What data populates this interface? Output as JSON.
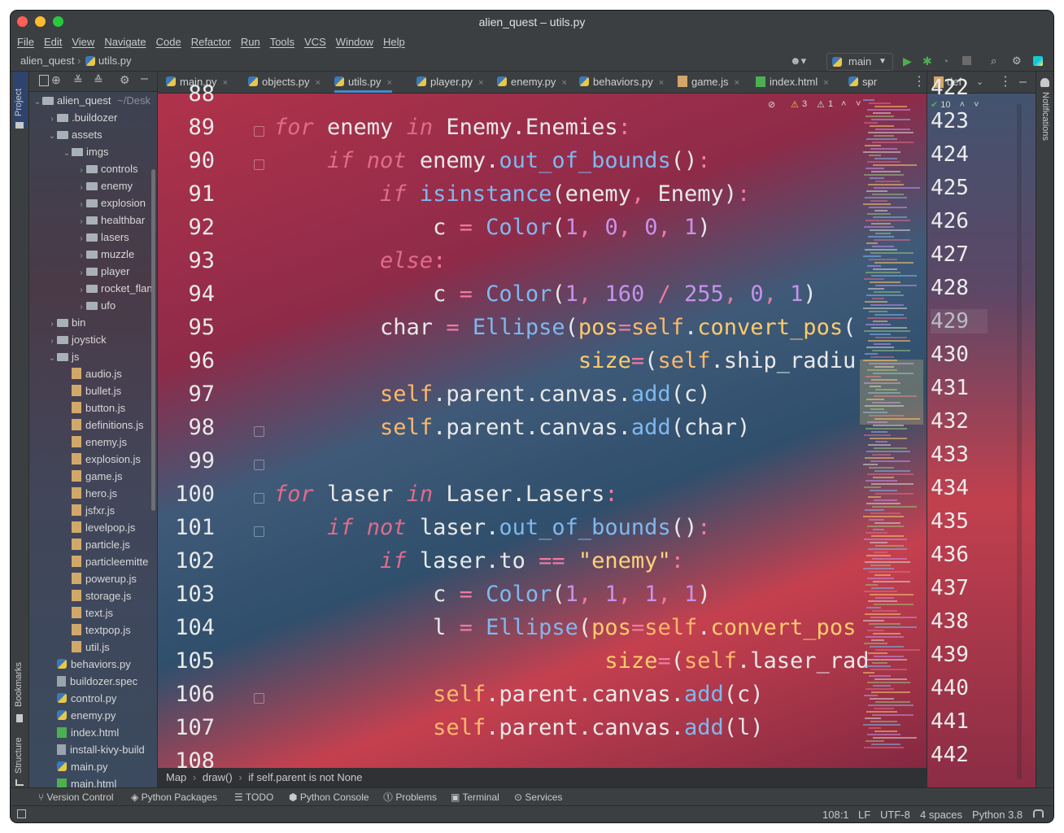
{
  "window": {
    "title": "alien_quest – utils.py"
  },
  "menu": [
    "File",
    "Edit",
    "View",
    "Navigate",
    "Code",
    "Refactor",
    "Run",
    "Tools",
    "VCS",
    "Window",
    "Help"
  ],
  "nav": {
    "project": "alien_quest",
    "file": "utils.py",
    "branch": "main"
  },
  "side_tools": {
    "project": "Project",
    "bookmarks": "Bookmarks",
    "structure": "Structure",
    "notifications": "Notifications"
  },
  "project_tree": {
    "root": "alien_quest",
    "root_path": "~/Desk",
    "items": [
      {
        "label": ".buildozer",
        "kind": "folder",
        "depth": 1,
        "exp": "collapsed"
      },
      {
        "label": "assets",
        "kind": "folder",
        "depth": 1,
        "exp": "expanded"
      },
      {
        "label": "imgs",
        "kind": "folder",
        "depth": 2,
        "exp": "expanded"
      },
      {
        "label": "controls",
        "kind": "folder",
        "depth": 3,
        "exp": "collapsed"
      },
      {
        "label": "enemy",
        "kind": "folder",
        "depth": 3,
        "exp": "collapsed"
      },
      {
        "label": "explosion",
        "kind": "folder",
        "depth": 3,
        "exp": "collapsed"
      },
      {
        "label": "healthbar",
        "kind": "folder",
        "depth": 3,
        "exp": "collapsed"
      },
      {
        "label": "lasers",
        "kind": "folder",
        "depth": 3,
        "exp": "collapsed"
      },
      {
        "label": "muzzle",
        "kind": "folder",
        "depth": 3,
        "exp": "collapsed"
      },
      {
        "label": "player",
        "kind": "folder",
        "depth": 3,
        "exp": "collapsed"
      },
      {
        "label": "rocket_flan",
        "kind": "folder",
        "depth": 3,
        "exp": "collapsed"
      },
      {
        "label": "ufo",
        "kind": "folder",
        "depth": 3,
        "exp": "collapsed"
      },
      {
        "label": "bin",
        "kind": "folder",
        "depth": 1,
        "exp": "collapsed"
      },
      {
        "label": "joystick",
        "kind": "folder",
        "depth": 1,
        "exp": "collapsed"
      },
      {
        "label": "js",
        "kind": "folder",
        "depth": 1,
        "exp": "expanded"
      },
      {
        "label": "audio.js",
        "kind": "js",
        "depth": 2
      },
      {
        "label": "bullet.js",
        "kind": "js",
        "depth": 2
      },
      {
        "label": "button.js",
        "kind": "js",
        "depth": 2
      },
      {
        "label": "definitions.js",
        "kind": "js",
        "depth": 2
      },
      {
        "label": "enemy.js",
        "kind": "js",
        "depth": 2
      },
      {
        "label": "explosion.js",
        "kind": "js",
        "depth": 2
      },
      {
        "label": "game.js",
        "kind": "js",
        "depth": 2
      },
      {
        "label": "hero.js",
        "kind": "js",
        "depth": 2
      },
      {
        "label": "jsfxr.js",
        "kind": "js",
        "depth": 2
      },
      {
        "label": "levelpop.js",
        "kind": "js",
        "depth": 2
      },
      {
        "label": "particle.js",
        "kind": "js",
        "depth": 2
      },
      {
        "label": "particleemitte",
        "kind": "js",
        "depth": 2
      },
      {
        "label": "powerup.js",
        "kind": "js",
        "depth": 2
      },
      {
        "label": "storage.js",
        "kind": "js",
        "depth": 2
      },
      {
        "label": "text.js",
        "kind": "js",
        "depth": 2
      },
      {
        "label": "textpop.js",
        "kind": "js",
        "depth": 2
      },
      {
        "label": "util.js",
        "kind": "js",
        "depth": 2
      },
      {
        "label": "behaviors.py",
        "kind": "py",
        "depth": 1
      },
      {
        "label": "buildozer.spec",
        "kind": "gen",
        "depth": 1
      },
      {
        "label": "control.py",
        "kind": "py",
        "depth": 1
      },
      {
        "label": "enemy.py",
        "kind": "py",
        "depth": 1
      },
      {
        "label": "index.html",
        "kind": "html",
        "depth": 1
      },
      {
        "label": "install-kivy-build",
        "kind": "gen",
        "depth": 1
      },
      {
        "label": "main.py",
        "kind": "py",
        "depth": 1
      },
      {
        "label": "main.html",
        "kind": "html",
        "depth": 1
      }
    ]
  },
  "tabs": [
    {
      "label": "main.py",
      "kind": "py"
    },
    {
      "label": "objects.py",
      "kind": "py"
    },
    {
      "label": "utils.py",
      "kind": "py",
      "active": true
    },
    {
      "label": "player.py",
      "kind": "py"
    },
    {
      "label": "enemy.py",
      "kind": "py"
    },
    {
      "label": "behaviors.py",
      "kind": "py"
    },
    {
      "label": "game.js",
      "kind": "js"
    },
    {
      "label": "index.html",
      "kind": "html"
    },
    {
      "label": "spr",
      "kind": "py"
    }
  ],
  "right_tab": "def",
  "inspections": {
    "warnings": "3",
    "weak": "1",
    "right_ok": "10"
  },
  "code_lines": [
    {
      "n": "88",
      "html": ""
    },
    {
      "n": "89",
      "html": "<span class='kw'>for</span> enemy <span class='kw'>in</span> Enemy.Enemies<span class='op'>:</span>"
    },
    {
      "n": "90",
      "html": "    <span class='kw'>if not</span> enemy.<span class='fn'>out_of_bounds</span>()<span class='op'>:</span>"
    },
    {
      "n": "91",
      "html": "        <span class='kw'>if</span> <span class='fn'>isinstance</span>(enemy<span class='op'>,</span> Enemy)<span class='op'>:</span>"
    },
    {
      "n": "92",
      "html": "            c <span class='op'>=</span> <span class='fn'>Color</span>(<span class='num'>1</span><span class='op'>,</span> <span class='num'>0</span><span class='op'>,</span> <span class='num'>0</span><span class='op'>,</span> <span class='num'>1</span>)"
    },
    {
      "n": "93",
      "html": "        <span class='kw'>else</span><span class='op'>:</span>"
    },
    {
      "n": "94",
      "html": "            c <span class='op'>=</span> <span class='fn'>Color</span>(<span class='num'>1</span><span class='op'>,</span> <span class='num'>160</span> <span class='op'>/</span> <span class='num'>255</span><span class='op'>,</span> <span class='num'>0</span><span class='op'>,</span> <span class='num'>1</span>)"
    },
    {
      "n": "95",
      "html": "        char <span class='op'>=</span> <span class='fn'>Ellipse</span>(<span class='param'>pos</span><span class='op'>=</span><span class='self'>self</span>.<span class='param'>convert_pos</span>("
    },
    {
      "n": "96",
      "html": "                       <span class='param'>size</span><span class='op'>=</span>(<span class='self'>self</span>.ship_radiu"
    },
    {
      "n": "97",
      "html": "        <span class='self'>self</span>.parent.canvas.<span class='fn'>add</span>(c)"
    },
    {
      "n": "98",
      "html": "        <span class='self'>self</span>.parent.canvas.<span class='fn'>add</span>(char)"
    },
    {
      "n": "99",
      "html": ""
    },
    {
      "n": "100",
      "html": "<span class='kw'>for</span> laser <span class='kw'>in</span> Laser.Lasers<span class='op'>:</span>"
    },
    {
      "n": "101",
      "html": "    <span class='kw'>if not</span> laser.<span class='fn'>out_of_bounds</span>()<span class='op'>:</span>"
    },
    {
      "n": "102",
      "html": "        <span class='kw'>if</span> laser.to <span class='op'>==</span> <span class='str'>\"enemy\"</span><span class='op'>:</span>"
    },
    {
      "n": "103",
      "html": "            c <span class='op'>=</span> <span class='fn'>Color</span>(<span class='num'>1</span><span class='op'>,</span> <span class='num'>1</span><span class='op'>,</span> <span class='num'>1</span><span class='op'>,</span> <span class='num'>1</span>)"
    },
    {
      "n": "104",
      "html": "            l <span class='op'>=</span> <span class='fn'>Ellipse</span>(<span class='param'>pos</span><span class='op'>=</span><span class='self'>self</span>.<span class='param'>convert_pos</span>"
    },
    {
      "n": "105",
      "html": "                         <span class='param'>size</span><span class='op'>=</span>(<span class='self'>self</span>.laser_rad"
    },
    {
      "n": "106",
      "html": "            <span class='self'>self</span>.parent.canvas.<span class='fn'>add</span>(c)"
    },
    {
      "n": "107",
      "html": "            <span class='self'>self</span>.parent.canvas.<span class='fn'>add</span>(l)"
    },
    {
      "n": "108",
      "html": ""
    }
  ],
  "diff_lines": [
    "422",
    "423",
    "424",
    "425",
    "426",
    "427",
    "428",
    "429",
    "430",
    "431",
    "432",
    "433",
    "434",
    "435",
    "436",
    "437",
    "438",
    "439",
    "440",
    "441",
    "442"
  ],
  "breadcrumb": [
    "Map",
    "draw()",
    "if self.parent is not None"
  ],
  "tool_windows": [
    "Version Control",
    "Python Packages",
    "TODO",
    "Python Console",
    "Problems",
    "Terminal",
    "Services"
  ],
  "status": {
    "position": "108:1",
    "line_sep": "LF",
    "encoding": "UTF-8",
    "indent": "4 spaces",
    "interpreter": "Python 3.8"
  }
}
